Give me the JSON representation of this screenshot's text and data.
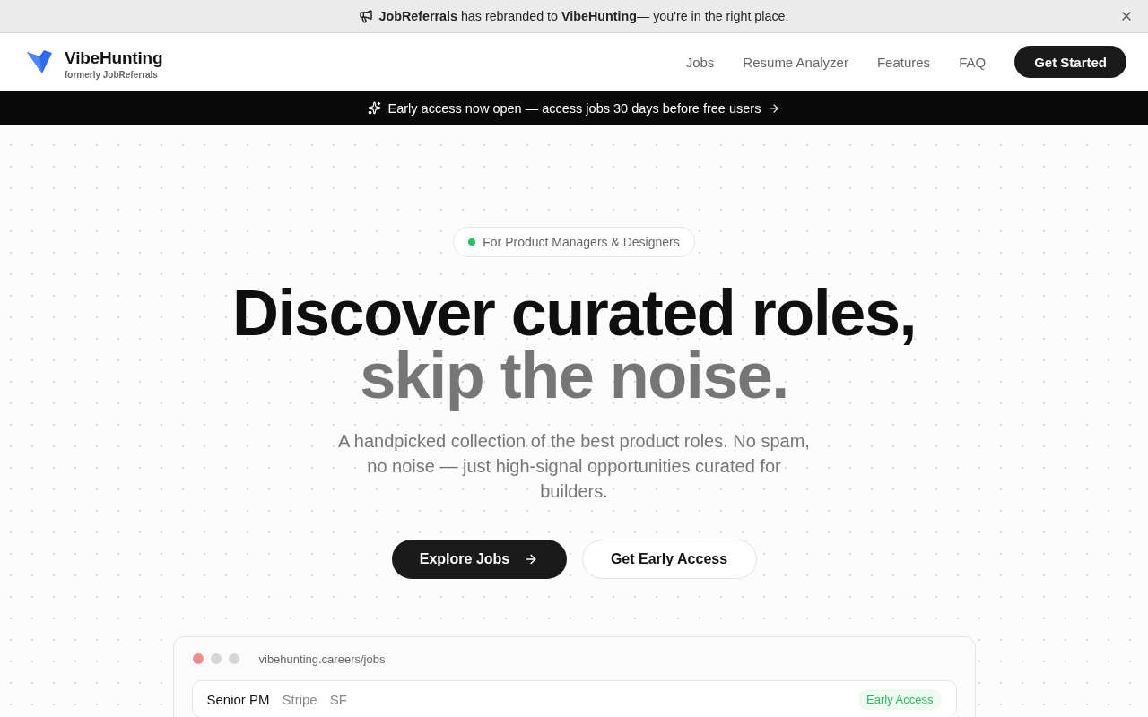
{
  "announcement": {
    "text": "**JobReferrals** has rebranded to **VibeHunting**— you're in the right place."
  },
  "header": {
    "brand": "VibeHunting",
    "tagline": "formerly JobReferrals",
    "nav": [
      {
        "label": "Jobs"
      },
      {
        "label": "Resume Analyzer"
      },
      {
        "label": "Features"
      },
      {
        "label": "FAQ"
      }
    ],
    "cta": "Get Started"
  },
  "promo_bar": {
    "text": "Early access now open — access jobs 30 days before free users"
  },
  "hero": {
    "badge": "For Product Managers & Designers",
    "headline": "Discover curated roles,",
    "headline_muted": "skip the noise.",
    "subtitle": "A handpicked collection of the best product roles. No spam, no noise — just high-signal opportunities curated for builders.",
    "primary_button": "Explore Jobs",
    "secondary_button": "Get Early Access"
  },
  "preview": {
    "url": "vibehunting.careers/jobs",
    "jobs": [
      {
        "title": "Senior PM",
        "company": "Stripe",
        "location": "SF",
        "tag": "Early Access"
      }
    ]
  }
}
